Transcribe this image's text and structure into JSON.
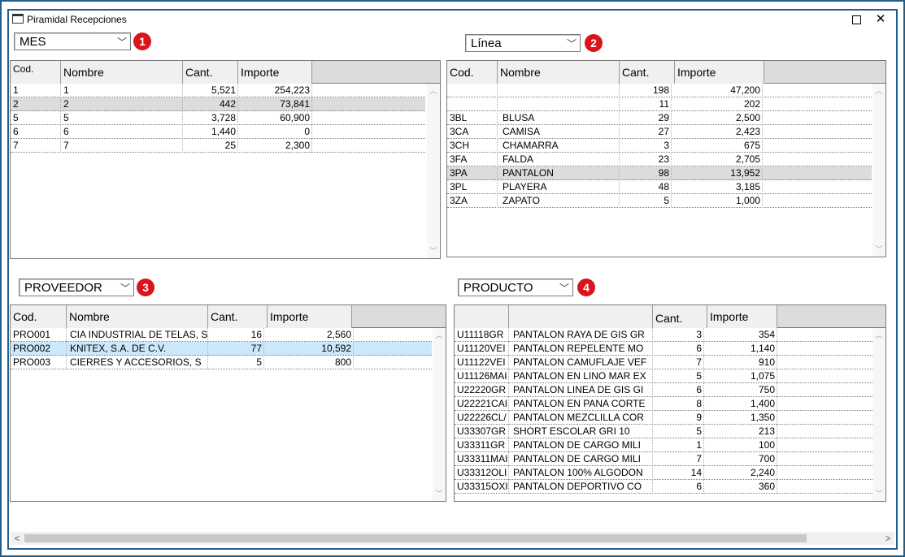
{
  "window": {
    "title": "Piramidal Recepciones"
  },
  "controls": {
    "mes": {
      "value": "MES",
      "badge": "1"
    },
    "linea": {
      "value": "Línea",
      "badge": "2"
    },
    "proveedor": {
      "value": "PROVEEDOR",
      "badge": "3"
    },
    "producto": {
      "value": "PRODUCTO",
      "badge": "4"
    }
  },
  "grid_mes": {
    "headers": [
      "Cod.",
      "Nombre",
      "Cant.",
      "Importe"
    ],
    "rows": [
      [
        "1",
        "1",
        "5,521",
        "254,223"
      ],
      [
        "2",
        "2",
        "442",
        "73,841"
      ],
      [
        "5",
        "5",
        "3,728",
        "60,900"
      ],
      [
        "6",
        "6",
        "1,440",
        "0"
      ],
      [
        "7",
        "7",
        "25",
        "2,300"
      ]
    ]
  },
  "grid_linea": {
    "headers": [
      "Cod.",
      "Nombre",
      "Cant.",
      "Importe"
    ],
    "rows": [
      [
        "",
        "",
        "198",
        "47,200"
      ],
      [
        "",
        "",
        "11",
        "202"
      ],
      [
        "3BL",
        "BLUSA",
        "29",
        "2,500"
      ],
      [
        "3CA",
        "CAMISA",
        "27",
        "2,423"
      ],
      [
        "3CH",
        "CHAMARRA",
        "3",
        "675"
      ],
      [
        "3FA",
        "FALDA",
        "23",
        "2,705"
      ],
      [
        "3PA",
        "PANTALON",
        "98",
        "13,952"
      ],
      [
        "3PL",
        "PLAYERA",
        "48",
        "3,185"
      ],
      [
        "3ZA",
        "ZAPATO",
        "5",
        "1,000"
      ]
    ]
  },
  "grid_proveedor": {
    "headers": [
      "Cod.",
      "Nombre",
      "Cant.",
      "Importe"
    ],
    "rows": [
      [
        "PRO001",
        "CIA INDUSTRIAL DE TELAS, S",
        "16",
        "2,560"
      ],
      [
        "PRO002",
        "KNITEX, S.A. DE C.V.",
        "77",
        "10,592"
      ],
      [
        "PRO003",
        "CIERRES Y ACCESORIOS, S",
        "5",
        "800"
      ]
    ]
  },
  "grid_producto": {
    "headers": [
      "",
      "",
      "Cant.",
      "Importe"
    ],
    "rows": [
      [
        "U11118GR",
        "PANTALON RAYA DE GIS GR",
        "3",
        "354"
      ],
      [
        "U11120VEI",
        "PANTALON REPELENTE MO",
        "6",
        "1,140"
      ],
      [
        "U11122VEI",
        "PANTALON CAMUFLAJE VEF",
        "7",
        "910"
      ],
      [
        "U11126MAI",
        "PANTALON EN LINO MAR EX",
        "5",
        "1,075"
      ],
      [
        "U22220GR",
        "PANTALON LINEA DE GIS GI",
        "6",
        "750"
      ],
      [
        "U22221CAI",
        "PANTALON EN PANA CORTE",
        "8",
        "1,400"
      ],
      [
        "U22226CL/",
        "PANTALON MEZCLILLA COR",
        "9",
        "1,350"
      ],
      [
        "U33307GR",
        "SHORT ESCOLAR GRI 10",
        "5",
        "213"
      ],
      [
        "U33311GR",
        "PANTALON DE CARGO MILI",
        "1",
        "100"
      ],
      [
        "U33311MAI",
        "PANTALON DE CARGO MILI",
        "7",
        "700"
      ],
      [
        "U33312OLI",
        "PANTALON 100%  ALGODON",
        "14",
        "2,240"
      ],
      [
        "U33315OXI",
        "PANTALON  DEPORTIVO CO",
        "6",
        "360"
      ]
    ]
  }
}
